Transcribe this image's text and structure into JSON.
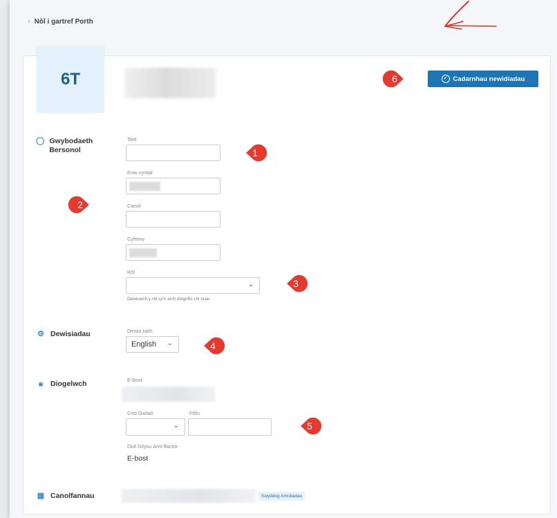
{
  "nav": {
    "back_label": "Nôl i gartref Porth"
  },
  "profile": {
    "avatar_initials": "6T"
  },
  "actions": {
    "confirm_label": "Cadarnhau newidiadau"
  },
  "personal": {
    "title": "Gwybodaeth Bersonol",
    "fields": {
      "title_label": "Teitl",
      "first_name_label": "Enw cyntaf",
      "middle_label": "Canol",
      "surname_label": "Cyfenw",
      "role_label": "Rôl",
      "role_help": "Dewiswch y rôl sy'n eich disgrifio chi orau"
    }
  },
  "preferences": {
    "title": "Dewisiadau",
    "language_label": "Dewis Iaith",
    "language_value": "English"
  },
  "security": {
    "title": "Diogelwch",
    "email_label": "E-bost",
    "country_code_label": "Cod Gwlad",
    "phone_label": "Ffôn",
    "mfa_label": "Dull Dilysu Aml-ffactor",
    "mfa_value": "E-bost"
  },
  "centres": {
    "title": "Canolfannau",
    "badge": "Swyddog Arholiadau"
  },
  "annotations": [
    "1",
    "2",
    "3",
    "4",
    "5",
    "6"
  ],
  "colors": {
    "accent": "#1d75b5",
    "marker": "#e8392f",
    "avatar_bg": "#e3f1fb"
  }
}
